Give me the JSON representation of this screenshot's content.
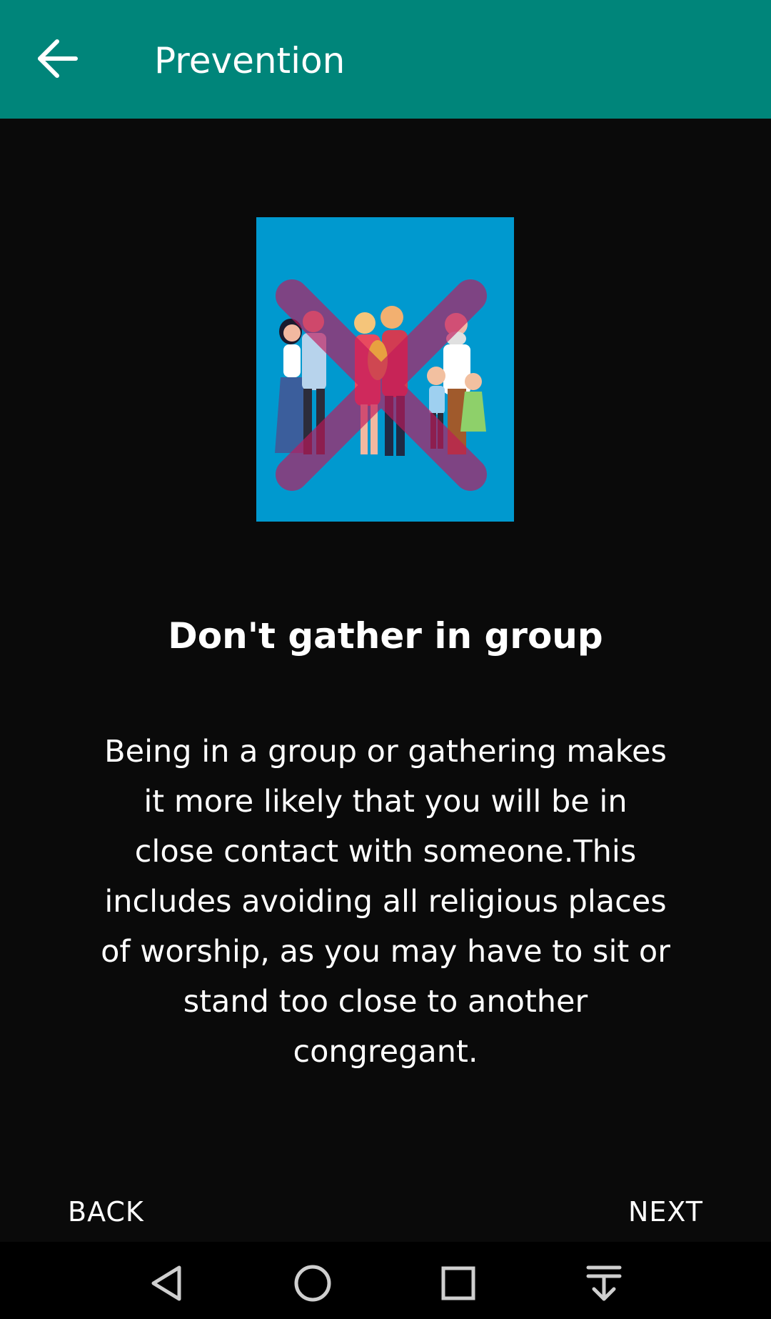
{
  "header": {
    "title": "Prevention",
    "back_icon": "arrow-back-icon"
  },
  "colors": {
    "appbar": "#00857a",
    "background": "#0a0a0a",
    "illustration_bg": "#0099cf",
    "cross": "#c2185b"
  },
  "content": {
    "illustration": "group-of-people-crossed-out",
    "heading": "Don't gather in group",
    "body": "Being in a group or gathering makes it more likely that you will be in close contact with someone.This includes avoiding all religious places of worship, as you may have to sit or stand too close to another congregant."
  },
  "navigation": {
    "back_label": "BACK",
    "next_label": "NEXT"
  },
  "system_bar": {
    "icons": [
      "back-triangle-icon",
      "home-circle-icon",
      "recents-square-icon",
      "notification-pull-icon"
    ]
  }
}
